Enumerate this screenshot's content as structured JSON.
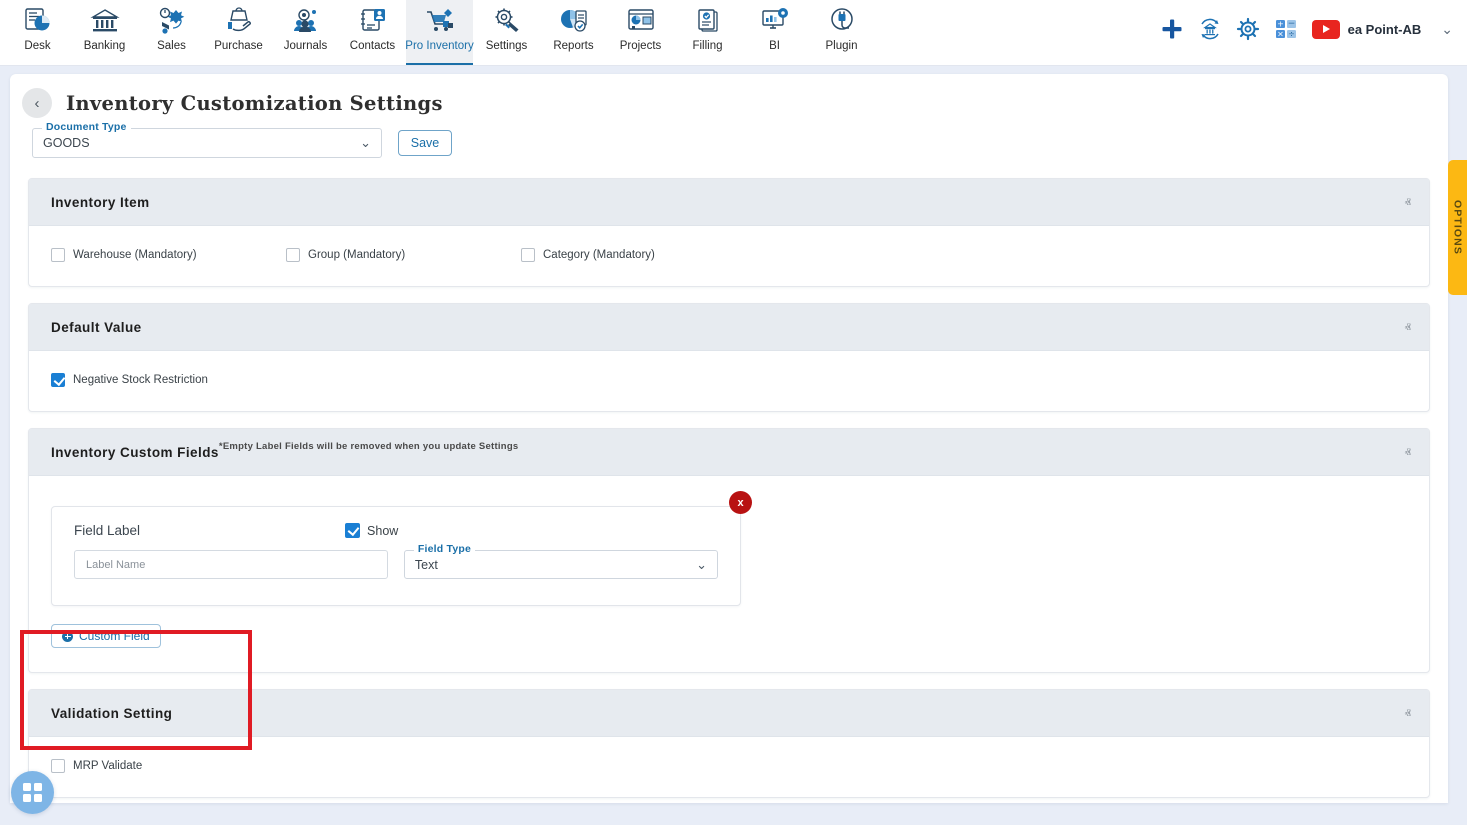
{
  "topnav": {
    "items": [
      {
        "label": "Desk",
        "icon": "desk-dashboard-icon",
        "active": false
      },
      {
        "label": "Banking",
        "icon": "bank-building-icon",
        "active": false
      },
      {
        "label": "Sales",
        "icon": "sales-megaphone-icon",
        "active": false
      },
      {
        "label": "Purchase",
        "icon": "purchase-hand-bag-icon",
        "active": false
      },
      {
        "label": "Journals",
        "icon": "journals-gear-people-icon",
        "active": false
      },
      {
        "label": "Contacts",
        "icon": "contacts-book-icon",
        "active": false
      },
      {
        "label": "Pro Inventory",
        "icon": "inventory-cart-icon",
        "active": true
      },
      {
        "label": "Settings",
        "icon": "settings-gear-wrench-icon",
        "active": false
      },
      {
        "label": "Reports",
        "icon": "reports-piechart-icon",
        "active": false
      },
      {
        "label": "Projects",
        "icon": "projects-board-icon",
        "active": false
      },
      {
        "label": "Filling",
        "icon": "filling-documents-icon",
        "active": false
      },
      {
        "label": "BI",
        "icon": "bi-monitor-icon",
        "active": false
      },
      {
        "label": "Plugin",
        "icon": "plugin-plug-icon",
        "active": false
      }
    ],
    "right_icons": [
      {
        "name": "add-plus-icon"
      },
      {
        "name": "bank-sync-icon"
      },
      {
        "name": "gear-settings-icon"
      },
      {
        "name": "calculator-icon"
      },
      {
        "name": "youtube-icon"
      }
    ],
    "user_name": "ea Point-AB",
    "user_caret": "⌄",
    "accent_blue": "#1a6fa8",
    "youtube_red": "#e8251f"
  },
  "header": {
    "back_icon": "chevron-left-icon",
    "back_glyph": "‹",
    "title": "Inventory Customization Settings"
  },
  "document_type": {
    "label": "Document Type",
    "value": "GOODS",
    "caret": "⌄"
  },
  "save_button": {
    "label": "Save"
  },
  "sections": [
    {
      "id": "inventory-item",
      "title": "Inventory Item",
      "note": "",
      "collapse_glyph": "ⱏ",
      "checkboxes": [
        {
          "label": "Warehouse (Mandatory)",
          "checked": false
        },
        {
          "label": "Group (Mandatory)",
          "checked": false
        },
        {
          "label": "Category (Mandatory)",
          "checked": false
        }
      ]
    },
    {
      "id": "default-value",
      "title": "Default Value",
      "note": "",
      "collapse_glyph": "ⱏ",
      "checkboxes": [
        {
          "label": "Negative Stock Restriction",
          "checked": true
        }
      ]
    },
    {
      "id": "inventory-custom-fields",
      "title": "Inventory Custom Fields",
      "note": "*Empty Label Fields will be removed when you update Settings",
      "collapse_glyph": "ⱏ",
      "checkboxes": []
    },
    {
      "id": "validation-setting",
      "title": "Validation Setting",
      "note": "",
      "collapse_glyph": "ⱏ",
      "checkboxes": [
        {
          "label": "MRP Validate",
          "checked": false
        }
      ]
    }
  ],
  "custom_field": {
    "delete_label": "x",
    "field_label_title": "Field Label",
    "show_label": "Show",
    "show_checked": true,
    "label_name_placeholder": "Label Name",
    "label_name_value": "",
    "field_type_label": "Field Type",
    "field_type_value": "Text",
    "field_type_caret": "⌄",
    "add_button_label": "Custom Field"
  },
  "options_tab": {
    "label": "OPTIONS",
    "color": "#fcb813"
  },
  "fab": {
    "name": "apps-grid-button"
  },
  "highlight": {
    "color": "#e01b24",
    "target": "validation-setting"
  }
}
